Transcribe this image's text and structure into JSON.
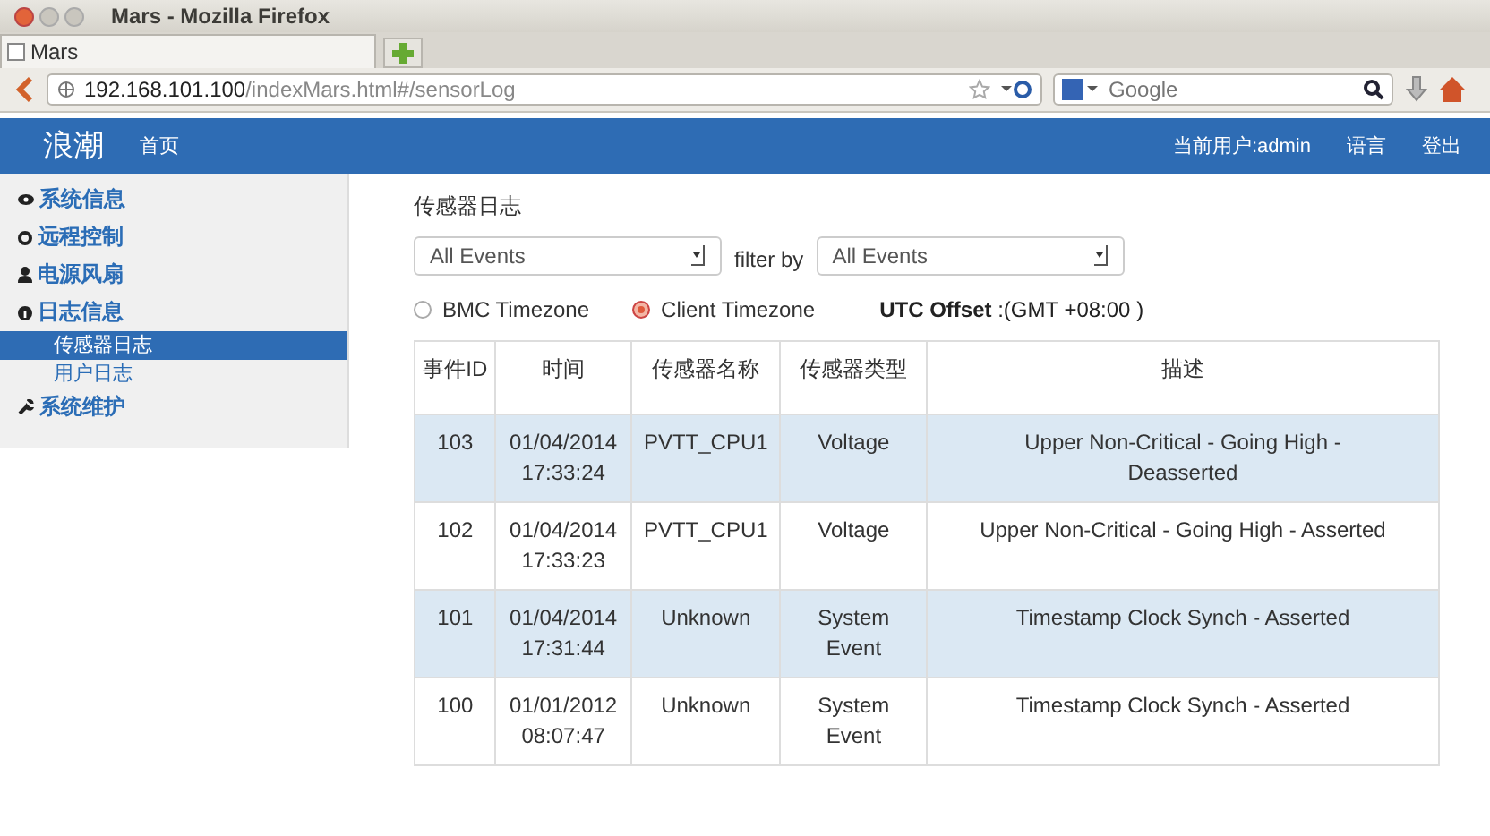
{
  "window": {
    "title": "Mars - Mozilla Firefox"
  },
  "tabs": [
    {
      "label": "Mars",
      "selected": true
    }
  ],
  "address_bar": {
    "host": "192.168.101.100",
    "path": "/indexMars.html#/sensorLog"
  },
  "search": {
    "placeholder": "Google"
  },
  "header": {
    "logo": "浪潮",
    "nav": [
      "首页"
    ],
    "user": "当前用户:admin",
    "links": [
      "语言",
      "登出"
    ]
  },
  "sidebar": {
    "items": [
      {
        "label": "系统信息",
        "selected": false
      },
      {
        "label": "远程控制",
        "selected": false
      },
      {
        "label": "电源风扇",
        "selected": false
      },
      {
        "label": "日志信息",
        "selected": false,
        "children": [
          {
            "label": "传感器日志",
            "selected": true
          },
          {
            "label": "用户日志",
            "selected": false
          }
        ]
      },
      {
        "label": "系统维护",
        "selected": false
      }
    ]
  },
  "page": {
    "title": "传感器日志",
    "filters": [
      {
        "value": "All Events"
      },
      {
        "label": "filter by",
        "value": "All Events"
      }
    ],
    "timezones": [
      {
        "label": "BMC Timezone",
        "selected": false
      },
      {
        "label": "Client Timezone",
        "selected": true
      }
    ],
    "utc_offset": {
      "label": "UTC Offset",
      "value": ":(GMT +08:00 )"
    }
  },
  "table": {
    "columns": [
      "事件ID",
      "时间",
      "传感器名称",
      "传感器类型",
      "描述"
    ],
    "rows": [
      [
        "103",
        "01/04/2014 17:33:24",
        "PVTT_CPU1",
        "Voltage",
        "Upper Non-Critical - Going High - Deasserted"
      ],
      [
        "102",
        "01/04/2014 17:33:23",
        "PVTT_CPU1",
        "Voltage",
        "Upper Non-Critical - Going High - Asserted"
      ],
      [
        "101",
        "01/04/2014 17:31:44",
        "Unknown",
        "System Event",
        "Timestamp Clock Synch - Asserted"
      ],
      [
        "100",
        "01/01/2012 08:07:47",
        "Unknown",
        "System Event",
        "Timestamp Clock Synch - Asserted"
      ]
    ]
  }
}
